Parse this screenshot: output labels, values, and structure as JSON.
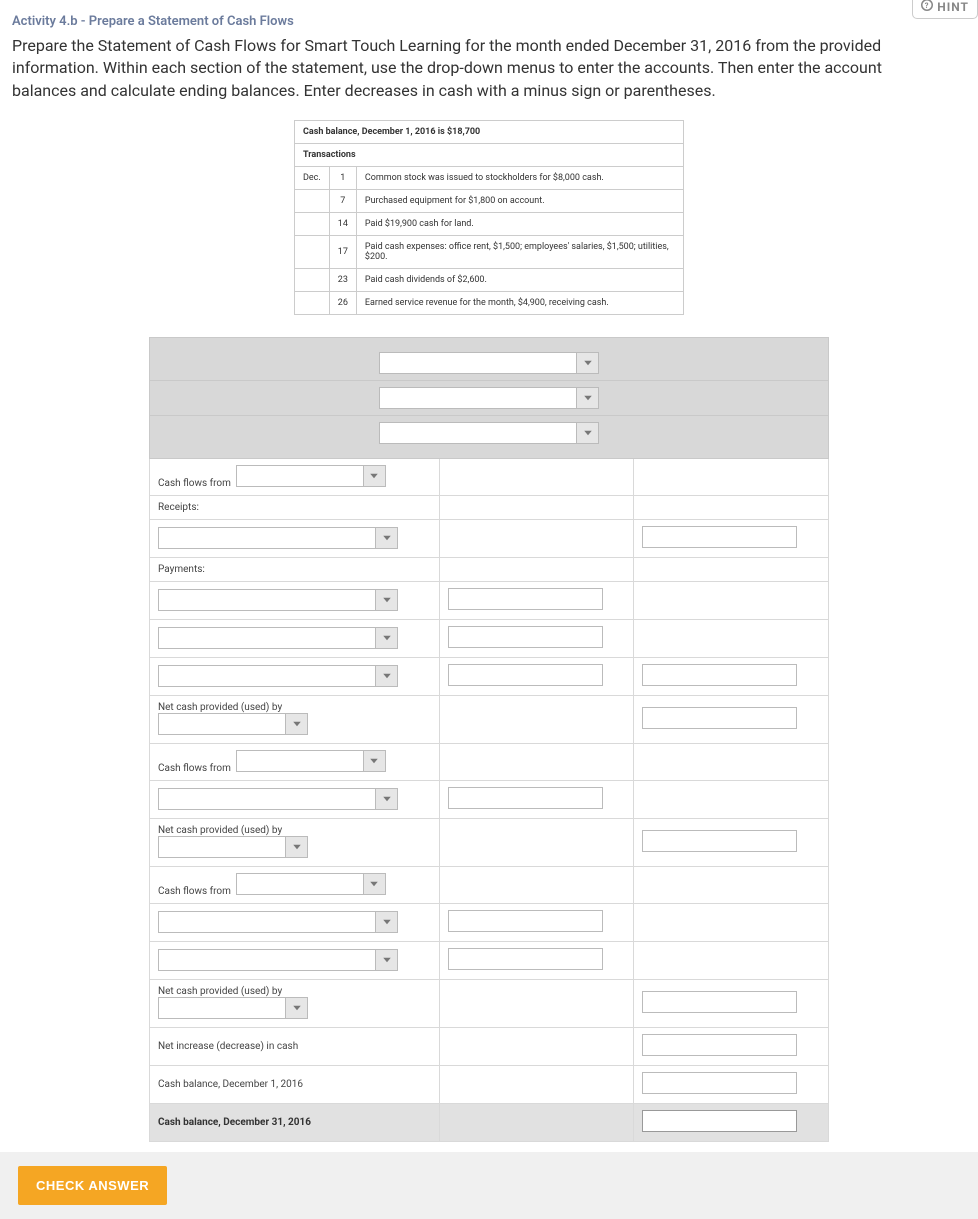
{
  "hint_label": "HINT",
  "activity_title": "Activity 4.b - Prepare a Statement of Cash Flows",
  "instructions": "Prepare the Statement of Cash Flows for Smart Touch Learning for the month ended December 31, 2016 from the provided information. Within each section of the statement, use the drop-down menus to enter the accounts. Then enter the account balances and calculate ending balances. Enter decreases in cash with a minus sign or parentheses.",
  "trans_box": {
    "header": "Cash balance, December 1, 2016 is $18,700",
    "subheader": "Transactions",
    "month": "Dec.",
    "rows": [
      {
        "day": "1",
        "text": "Common stock was issued to stockholders for $8,000 cash."
      },
      {
        "day": "7",
        "text": "Purchased equipment for $1,800 on account."
      },
      {
        "day": "14",
        "text": "Paid $19,900 cash for land."
      },
      {
        "day": "17",
        "text": "Paid cash expenses: office rent, $1,500; employees' salaries, $1,500; utilities, $200."
      },
      {
        "day": "23",
        "text": "Paid cash dividends of $2,600."
      },
      {
        "day": "26",
        "text": "Earned service revenue for the month, $4,900, receiving cash."
      }
    ]
  },
  "ws": {
    "cash_flows_from": "Cash flows from",
    "receipts": "Receipts:",
    "payments": "Payments:",
    "net_cash_provided": "Net cash provided (used) by",
    "net_increase": "Net increase (decrease) in cash",
    "cash_bal_begin": "Cash balance, December 1, 2016",
    "cash_bal_end": "Cash balance, December 31, 2016"
  },
  "footer": {
    "check": "CHECK ANSWER"
  }
}
